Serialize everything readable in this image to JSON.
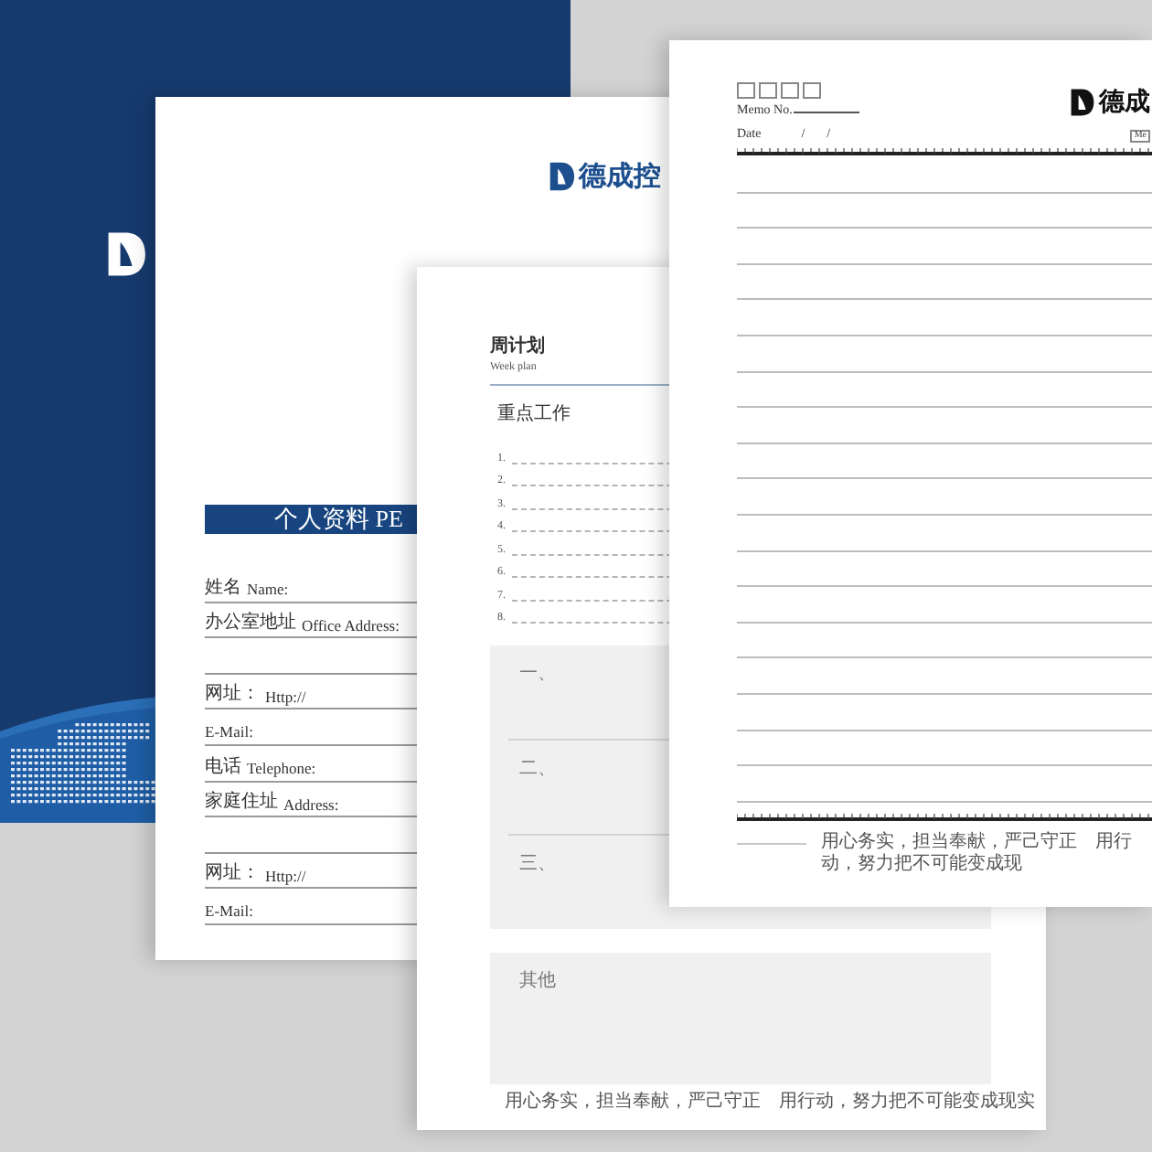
{
  "personal_sheet": {
    "logo_text": "德成控",
    "title": "个人资料 PE",
    "fields": [
      {
        "kind": "field",
        "label_zh": "姓名",
        "label_en": "Name:"
      },
      {
        "kind": "field",
        "label_zh": "办公室地址",
        "label_en": "Office Address:"
      },
      {
        "kind": "blank"
      },
      {
        "kind": "field",
        "label_zh": "网址：",
        "label_en": "Http://"
      },
      {
        "kind": "field",
        "label_en": "E-Mail:"
      },
      {
        "kind": "field",
        "label_zh": "电话",
        "label_en": "Telephone:"
      },
      {
        "kind": "field",
        "label_zh": "家庭住址",
        "label_en": "Address:"
      },
      {
        "kind": "blank"
      },
      {
        "kind": "field",
        "label_zh": "网址：",
        "label_en": "Http://"
      },
      {
        "kind": "field",
        "label_en": "E-Mail:"
      }
    ]
  },
  "week_plan_sheet": {
    "title": "周计划",
    "subtitle": "Week plan",
    "section_title": "重点工作",
    "items": [
      "1.",
      "2.",
      "3.",
      "4.",
      "5.",
      "6.",
      "7.",
      "8."
    ],
    "boxes": [
      {
        "kind": "section",
        "label": "一、"
      },
      {
        "kind": "section",
        "label": "二、"
      },
      {
        "kind": "section",
        "label": "三、"
      },
      {
        "kind": "other",
        "label": "其他"
      }
    ],
    "footer": "用心务实，担当奉献，严己守正　用行动，努力把不可能变成现实"
  },
  "memo_sheet": {
    "memo_no_label": "Memo No.",
    "date_label": "Date",
    "date_separators": [
      "/",
      "/"
    ],
    "logo_text": "德成",
    "tag": "Me",
    "footer": "用心务实，担当奉献，严己守正　用行动，努力把不可能变成现"
  }
}
